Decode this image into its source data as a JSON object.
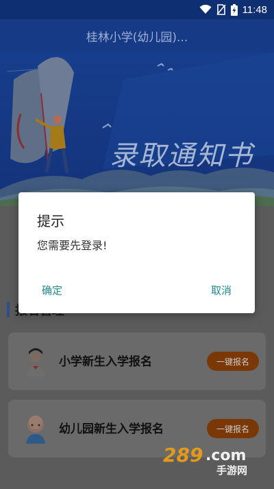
{
  "status_bar": {
    "time": "11:48"
  },
  "header": {
    "title": "桂林小学(幼儿园)..."
  },
  "banner": {
    "text": "录取通知书"
  },
  "section": {
    "title": "报名管理"
  },
  "cards": [
    {
      "label": "小学新生入学报名",
      "button": "一键报名"
    },
    {
      "label": "幼儿园新生入学报名",
      "button": "一键报名"
    }
  ],
  "dialog": {
    "title": "提示",
    "message": "您需要先登录!",
    "confirm": "确定",
    "cancel": "取消"
  },
  "watermark": {
    "number": "289",
    "suffix": ".com",
    "sub": "手游网"
  },
  "colors": {
    "primary": "#163a86",
    "button": "#c8620c",
    "dialog_accent": "#1e8a90"
  }
}
